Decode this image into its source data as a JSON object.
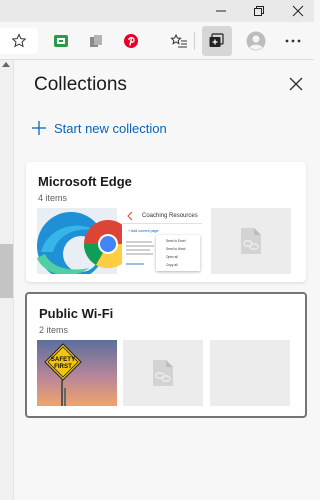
{
  "colors": {
    "accent": "#0a63b8",
    "panel_bg": "#f7f7f7",
    "card_bg": "#ffffff",
    "placeholder_bg": "#ececec"
  },
  "toolbar": {
    "icons": [
      "favorite-star-icon",
      "green-extension-icon",
      "grey-extension-icon",
      "pinterest-icon",
      "favorites-list-icon",
      "collections-icon",
      "profile-avatar-icon",
      "more-options-icon"
    ]
  },
  "panel": {
    "title": "Collections",
    "new_collection_label": "Start new collection"
  },
  "collections": [
    {
      "name": "Microsoft Edge",
      "count": "4 items",
      "thumbs": [
        "edge-logo-image",
        "chrome-logo-image",
        "coaching-resources-page",
        "placeholder"
      ],
      "preview": {
        "title": "Coaching Resources",
        "add_link": "+ Add current page",
        "menu": [
          "Send to Excel",
          "Send to Word",
          "Open all",
          "Copy all"
        ]
      }
    },
    {
      "name": "Public Wi-Fi",
      "count": "2 items",
      "thumbs": [
        "safety-first-sign-image",
        "placeholder",
        "empty"
      ],
      "sign_text": [
        "SAFETY",
        "FIRST"
      ]
    }
  ]
}
